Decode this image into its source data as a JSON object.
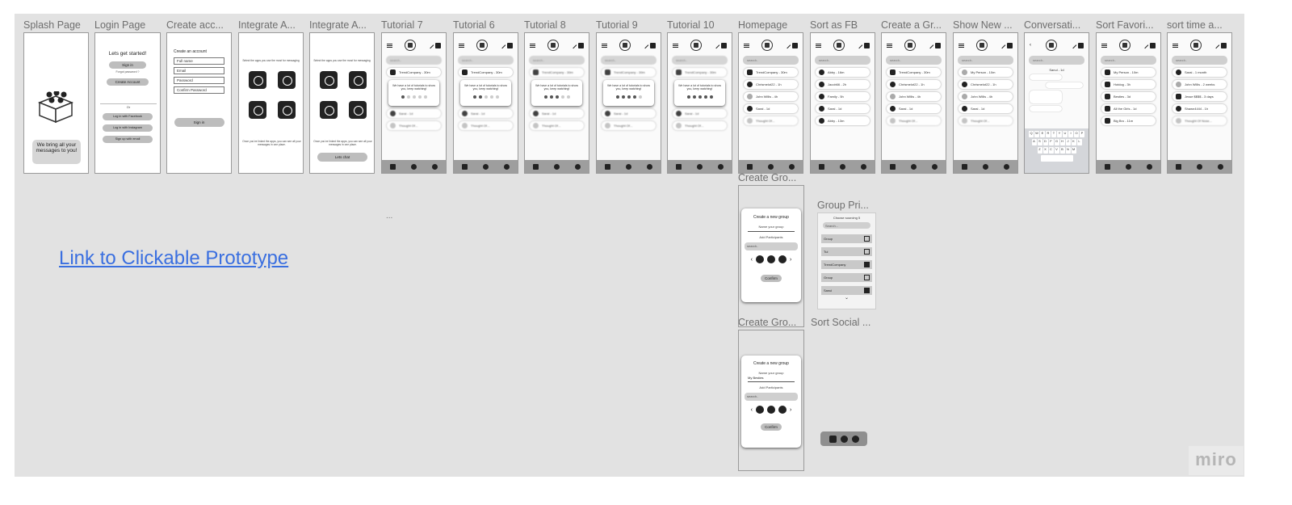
{
  "board": {
    "link_text": "Link to Clickable Prototype",
    "watermark": "miro",
    "ellipsis": "..."
  },
  "frames": {
    "splash": {
      "title": "Splash Page",
      "tagline": "We bring all your messages to you!"
    },
    "login": {
      "title": "Login Page",
      "heading": "Lets get started!",
      "sign_in": "Sign in",
      "forgot": "Forgot password ?",
      "create": "Create Account",
      "or": "Or",
      "facebook": "Log in with Facebook",
      "instagram": "Log in with Instagram",
      "email": "Sign up with email"
    },
    "create_account": {
      "title": "Create acc...",
      "heading": "Create an account",
      "full_name": "Full name",
      "email": "Email",
      "password": "Password",
      "confirm": "Confirm Password",
      "sign_in": "Sign in"
    },
    "integrate1": {
      "title": "Integrate A...",
      "desc": "Select the apps you use the most for messaging",
      "foot": "Once you've linked the apps, you can see all your messages in one place."
    },
    "integrate2": {
      "title": "Integrate A...",
      "desc": "Select the apps you use the most for messaging",
      "foot": "Once you've linked the apps, you can see all your messages in one place.",
      "btn": "Lets chat"
    },
    "tut7": {
      "title": "Tutorial 7"
    },
    "tut6": {
      "title": "Tutorial 6"
    },
    "tut8": {
      "title": "Tutorial 8"
    },
    "tut9": {
      "title": "Tutorial 9"
    },
    "tut10": {
      "title": "Tutorial 10"
    },
    "homepage": {
      "title": "Homepage"
    },
    "sortfb": {
      "title": "Sort as FB"
    },
    "creategroup": {
      "title": "Create a Gr..."
    },
    "shownew": {
      "title": "Show New ..."
    },
    "convo": {
      "title": "Conversati..."
    },
    "sortfav": {
      "title": "Sort Favori..."
    },
    "sorttime": {
      "title": "sort time a..."
    },
    "creategroup2": {
      "title": "Create Gro...",
      "heading": "Create a new group",
      "name": "Name your group",
      "add": "Add Participants",
      "search": "search..",
      "confirm": "Confirm"
    },
    "groupprivacy": {
      "title": "Group Pri...",
      "heading": "Choose sourcing 5",
      "search": "Search...",
      "rows": [
        "Group",
        "Tui",
        "TrendCompany",
        "Group",
        "Sanul"
      ]
    },
    "creategroup3": {
      "title": "Create Gro...",
      "heading": "Create a new group",
      "name": "Name your group",
      "group_name": "My Besties",
      "add": "Add Participants",
      "search": "search..",
      "confirm": "Confirm"
    },
    "sortsocial": {
      "title": "Sort Social ..."
    }
  },
  "phone": {
    "search": "search..",
    "chats": [
      "TrendCompany - 30m",
      "Chrismelot22 - 1h",
      "John Willis - 4h",
      "Sarai - 1d",
      "Thought Of..."
    ],
    "fb_chats": [
      "Abby - 16m",
      "Jacob66 - 2h",
      "Family - 5h",
      "Sarai - 1d",
      "Abby - 13m"
    ],
    "fav_chats": [
      "My Person - 10m",
      "Hotdog - 3h",
      "Besties - 3d",
      "All the Girls - 1d",
      "Big Bro - 11m"
    ],
    "time_chats": [
      "Sarai - 1 month",
      "John Willis - 2 weeks",
      "Jesse $$$$ - 3 days",
      "Shawn4444 - 1h",
      "Thought Of Nose..."
    ],
    "tip": "We have a lot of tutorials to show you, keep watching!",
    "convo_name": "Sanul - 1d",
    "kb_row1": [
      "Q",
      "W",
      "E",
      "R",
      "T",
      "Y",
      "U",
      "I",
      "O",
      "P"
    ],
    "kb_row2": [
      "A",
      "S",
      "D",
      "F",
      "G",
      "H",
      "J",
      "K",
      "L"
    ],
    "kb_row3": [
      "Z",
      "X",
      "C",
      "V",
      "B",
      "N",
      "M"
    ]
  }
}
